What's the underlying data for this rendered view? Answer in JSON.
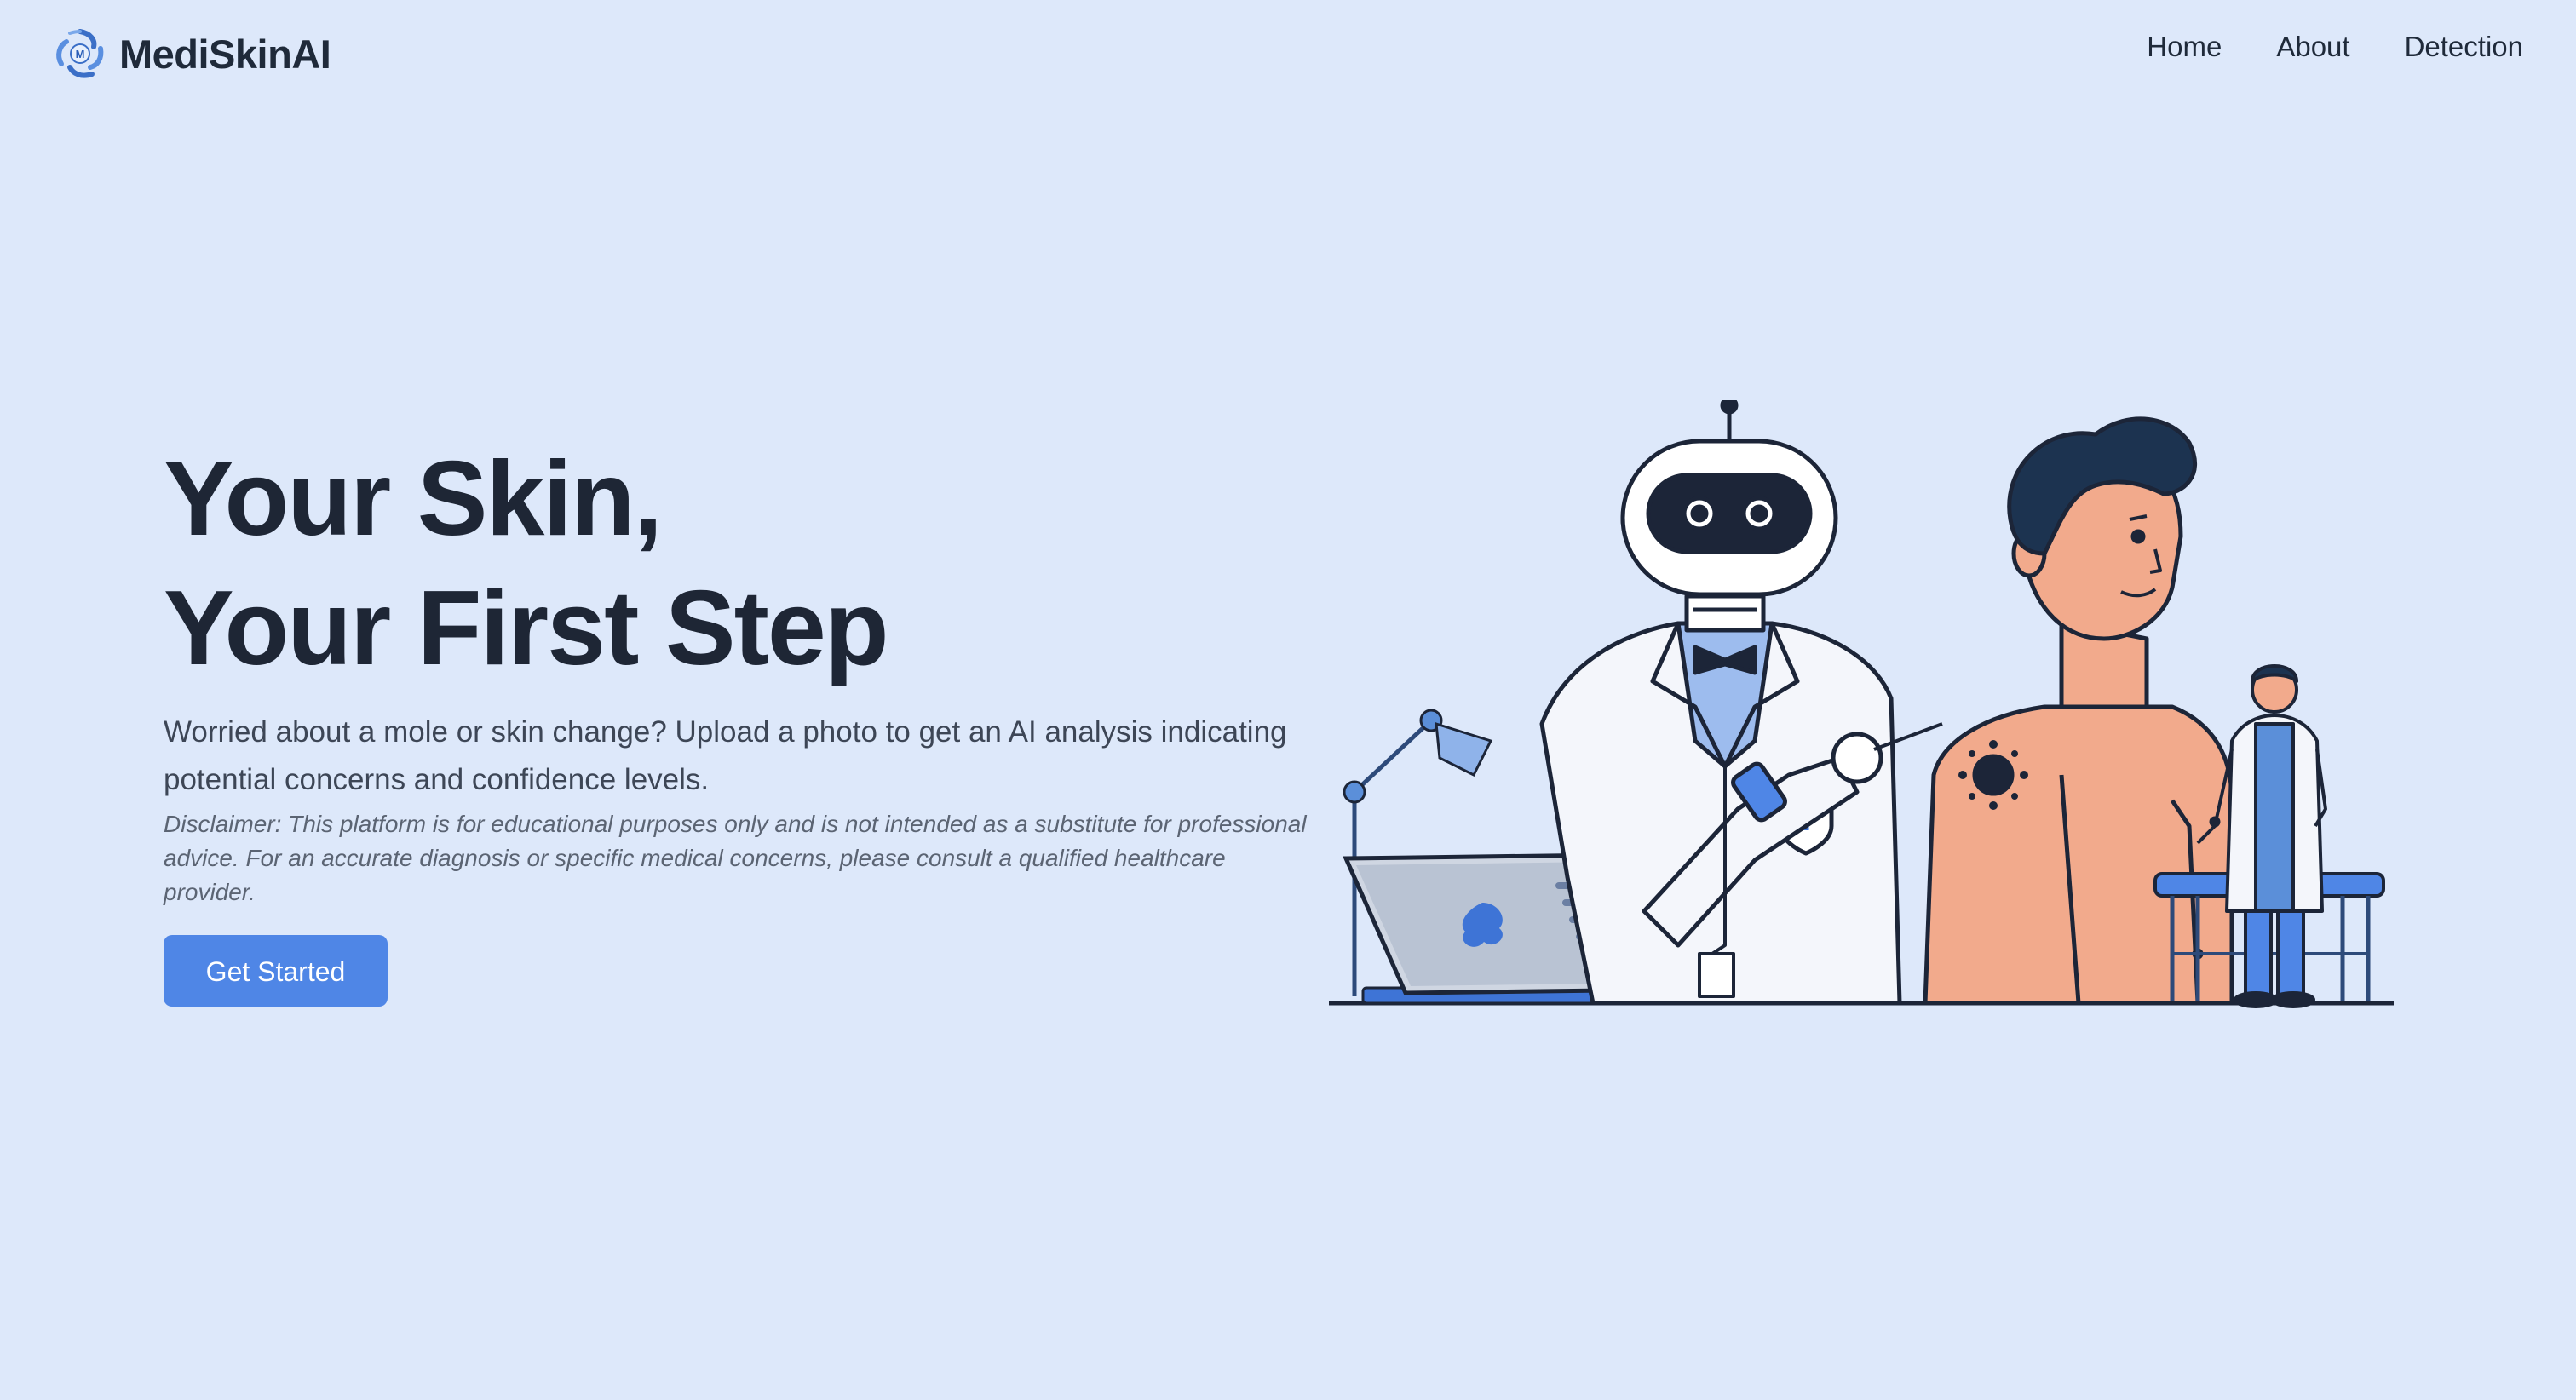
{
  "brand": {
    "name": "MediSkinAI",
    "logo_icon": "swirl-logo-icon",
    "logo_letter": "M"
  },
  "nav": {
    "links": [
      {
        "label": "Home"
      },
      {
        "label": "About"
      },
      {
        "label": "Detection"
      }
    ]
  },
  "hero": {
    "title_line1": "Your Skin,",
    "title_line2": "Your First Step",
    "description": "Worried about a mole or skin change? Upload a photo to get an AI analysis indicating potential concerns and confidence levels.",
    "disclaimer": "Disclaimer: This platform is for educational purposes only and is not intended as a substitute for professional advice. For an accurate diagnosis or specific medical concerns, please consult a qualified healthcare provider.",
    "cta_label": "Get Started"
  },
  "colors": {
    "background": "#dde8fa",
    "accent": "#4f86e6",
    "text_dark": "#1e2635"
  }
}
